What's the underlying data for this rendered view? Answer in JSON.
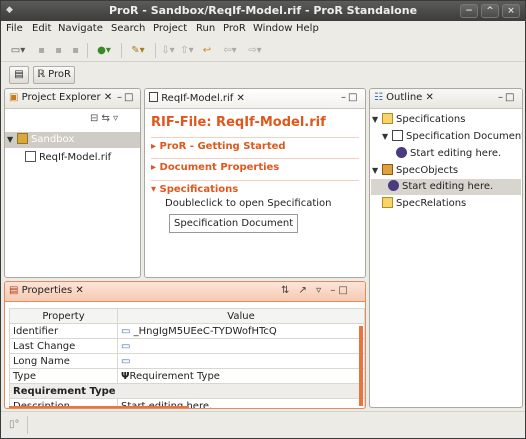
{
  "window": {
    "title": "ProR - Sandbox/ReqIf-Model.rif - ProR Standalone",
    "controls": [
      "−",
      "^",
      "×"
    ]
  },
  "menu": [
    "File",
    "Edit",
    "Navigate",
    "Search",
    "Project",
    "Run",
    "ProR",
    "Window",
    "Help"
  ],
  "perspective": {
    "label": "ProR"
  },
  "project_explorer": {
    "tab": "Project Explorer",
    "root": "Sandbox",
    "file": "ReqIf-Model.rif"
  },
  "editor": {
    "tab": "ReqIf-Model.rif",
    "heading": "RIF-File: ReqIf-Model.rif",
    "sections": [
      "ProR - Getting Started",
      "Document Properties",
      "Specifications"
    ],
    "hint": "Doubleclick to open Specification",
    "spec_button": "Specification Document"
  },
  "outline": {
    "tab": "Outline",
    "items": [
      "Specifications",
      "Specification Document",
      "Start editing here.",
      "SpecObjects",
      "Start editing here.",
      "SpecRelations"
    ]
  },
  "properties": {
    "tab": "Properties",
    "headers": [
      "Property",
      "Value"
    ],
    "rows": [
      {
        "property": "Identifier",
        "value": "_HngIgM5UEeC-TYDWofHTcQ"
      },
      {
        "property": "Last Change",
        "value": ""
      },
      {
        "property": "Long Name",
        "value": ""
      },
      {
        "property": "Type",
        "value": "Requirement Type"
      },
      {
        "property": "Requirement Type",
        "value": ""
      },
      {
        "property": "Description",
        "value": "Start editing here."
      }
    ]
  },
  "colors": {
    "accent": "#e0571c",
    "titlebar": "#4a4a48",
    "active_tab": "#f6c9b2"
  }
}
